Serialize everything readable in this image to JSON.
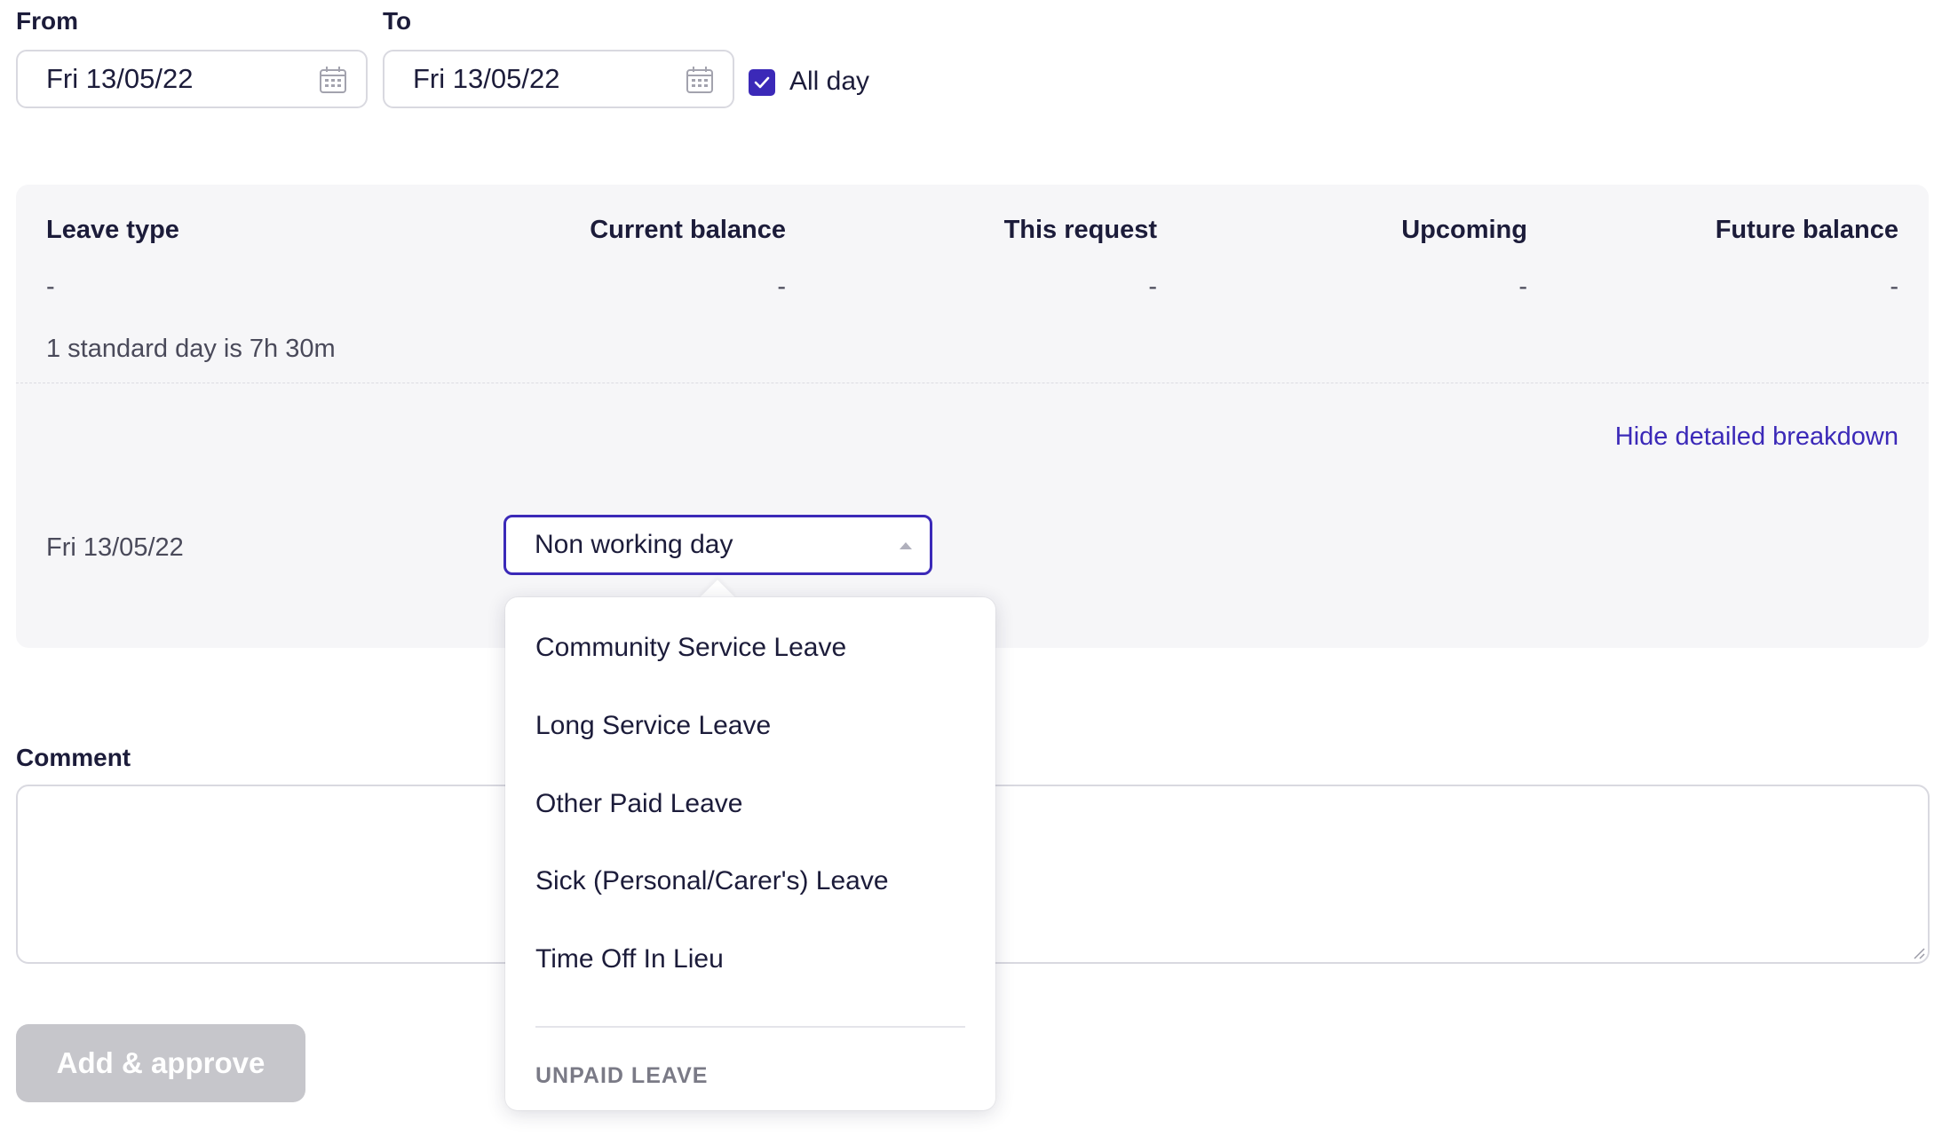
{
  "from": {
    "label": "From",
    "value": "Fri 13/05/22"
  },
  "to": {
    "label": "To",
    "value": "Fri 13/05/22"
  },
  "all_day": {
    "label": "All day",
    "checked": true
  },
  "balance_table": {
    "headers": [
      "Leave type",
      "Current balance",
      "This request",
      "Upcoming",
      "Future balance"
    ],
    "row": [
      "-",
      "-",
      "-",
      "-",
      "-"
    ],
    "note": "1 standard day is 7h 30m"
  },
  "breakdown": {
    "toggle_label": "Hide detailed breakdown",
    "date": "Fri 13/05/22",
    "selected": "Non working day"
  },
  "dropdown": {
    "options": [
      "Community Service Leave",
      "Long Service Leave",
      "Other Paid Leave",
      "Sick (Personal/Carer's) Leave",
      "Time Off In Lieu"
    ],
    "group_label": "UNPAID LEAVE"
  },
  "comment": {
    "label": "Comment",
    "value": ""
  },
  "submit": {
    "label": "Add & approve",
    "disabled": true
  },
  "colors": {
    "accent": "#3b29b8",
    "panel_bg": "#f6f6f8",
    "disabled_btn": "#c6c6cb"
  }
}
